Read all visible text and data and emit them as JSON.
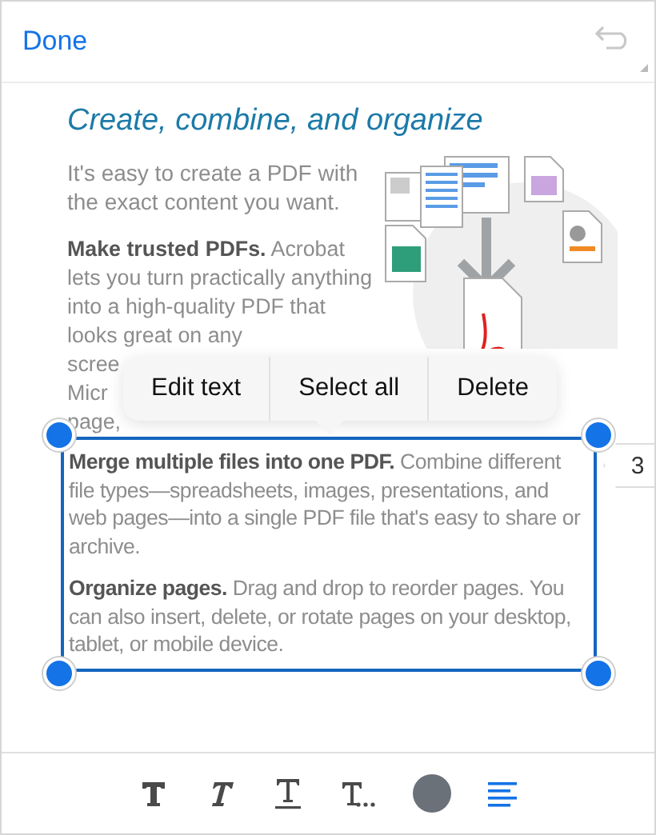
{
  "header": {
    "done_label": "Done"
  },
  "title": "Create, combine, and organize",
  "intro": "It's easy to create a PDF with the exact content you want.",
  "trusted": {
    "text": "**Make trusted PDFs.** Acrobat lets you turn practically anything into a high-quality PDF that looks great on any",
    "fragments": [
      "scree",
      "Micr",
      "page,"
    ]
  },
  "popover": {
    "items": [
      "Edit text",
      "Select all",
      "Delete"
    ]
  },
  "selection": {
    "paragraphs": [
      "**Merge multiple files into one PDF.** Combine different file types—spreadsheets, images, presentations, and web pages—into a single PDF file that's easy to share or archive.",
      "**Organize pages.** Drag and drop to reorder pages. You can also insert, delete, or rotate pages on your desktop, tablet, or mobile device."
    ]
  },
  "page_tab": "3",
  "toolbar": {
    "tools": [
      {
        "kind": "bold",
        "selected": false
      },
      {
        "kind": "italic",
        "selected": false
      },
      {
        "kind": "underline",
        "selected": false
      },
      {
        "kind": "more",
        "selected": false
      },
      {
        "kind": "color",
        "color": "#6b7178"
      },
      {
        "kind": "align",
        "selected": true
      }
    ]
  }
}
